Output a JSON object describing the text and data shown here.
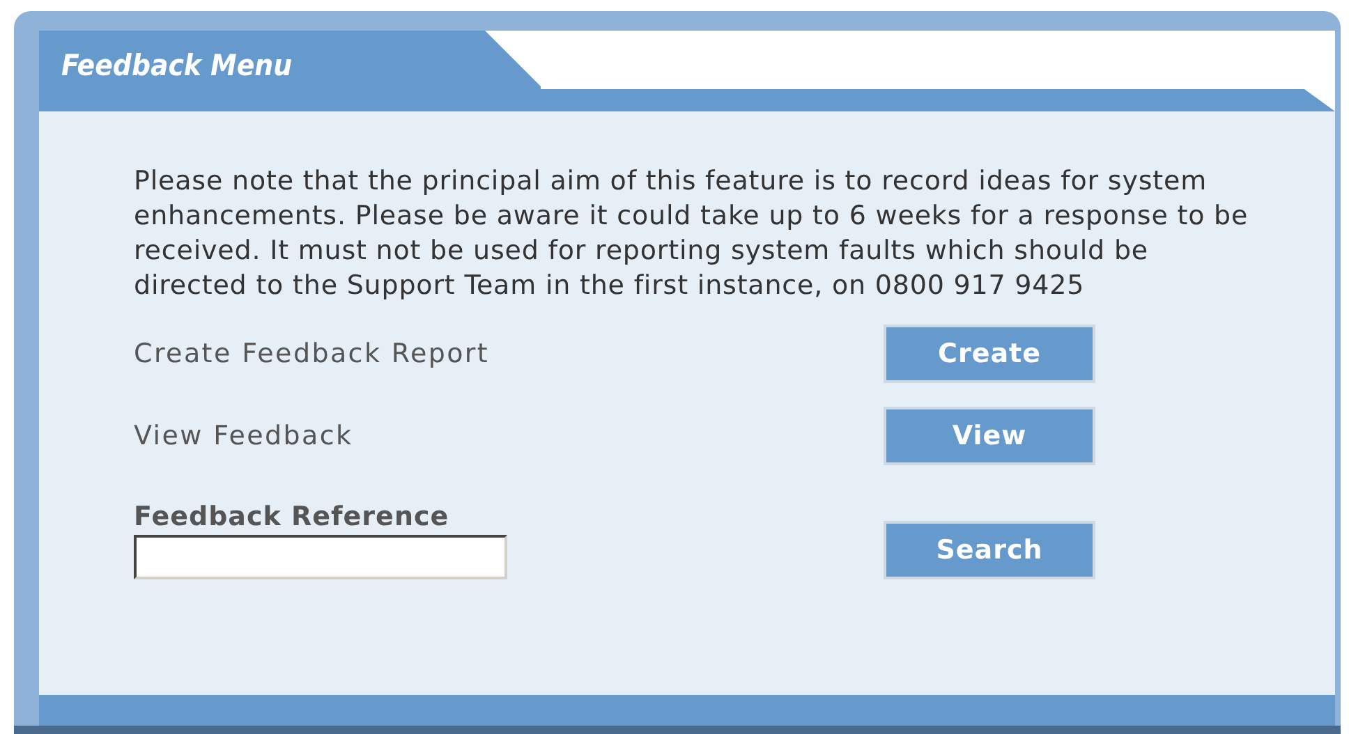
{
  "title": "Feedback Menu",
  "notice": "Please note that the principal aim of this feature is to record ideas for system enhancements. Please be aware it could take up to 6 weeks for a response to be received. It must not be used for reporting system faults which should be directed to the Support Team in the first instance, on 0800 917 9425",
  "actions": [
    {
      "label": "Create Feedback Report",
      "button": "Create"
    },
    {
      "label": "View Feedback",
      "button": "View"
    }
  ],
  "reference": {
    "label": "Feedback Reference",
    "button": "Search"
  }
}
